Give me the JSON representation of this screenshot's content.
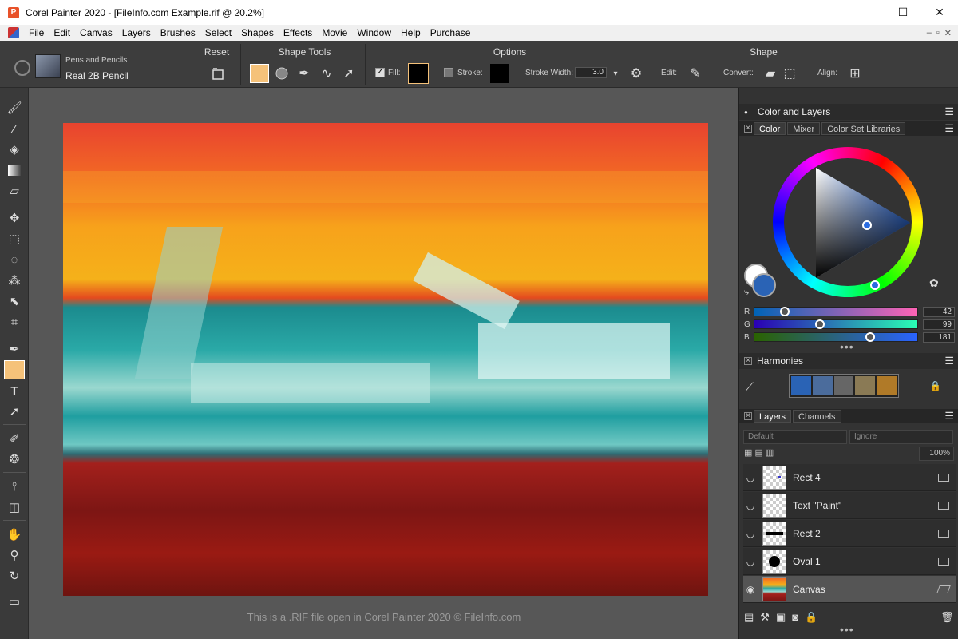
{
  "window": {
    "title": "Corel Painter 2020 - [FileInfo.com Example.rif @ 20.2%]",
    "app_icon": "painter-logo-icon",
    "minimize_glyph": "—",
    "maximize_glyph": "☐",
    "close_glyph": "✕"
  },
  "menu": {
    "items": [
      "File",
      "Edit",
      "Canvas",
      "Layers",
      "Brushes",
      "Select",
      "Shapes",
      "Effects",
      "Movie",
      "Window",
      "Help",
      "Purchase"
    ],
    "mdi_controls": [
      "–",
      "▫",
      "✕"
    ]
  },
  "property_bar": {
    "brush": {
      "category": "Pens and Pencils",
      "variant": "Real 2B Pencil"
    },
    "reset": {
      "heading": "Reset"
    },
    "shape_tools": {
      "heading": "Shape Tools"
    },
    "options": {
      "heading": "Options",
      "fill_label": "Fill:",
      "fill_checked": true,
      "stroke_label": "Stroke:",
      "stroke_checked": false,
      "stroke_width_label": "Stroke Width:",
      "stroke_width_value": "3.0",
      "fill_color": "#000000",
      "stroke_color": "#000000"
    },
    "shape": {
      "heading": "Shape",
      "edit_label": "Edit:",
      "convert_label": "Convert:",
      "align_label": "Align:"
    }
  },
  "toolbox": {
    "tools": [
      "brush-icon",
      "dropper-icon",
      "paint-bucket-icon",
      "gradient-icon",
      "eraser-icon",
      "transform-icon",
      "rect-select-icon",
      "lasso-icon",
      "magic-wand-icon",
      "selection-adjuster-icon",
      "crop-icon",
      "pen-icon",
      "rectangle-shape-icon",
      "text-icon",
      "shape-selection-icon",
      "cloner-icon",
      "blender-icon",
      "mirror-icon",
      "perspective-icon",
      "grabber-icon",
      "magnifier-icon",
      "rotate-page-icon",
      "screen-mode-icon"
    ],
    "selected": "rectangle-shape-icon"
  },
  "canvas": {
    "caption": "This is a .RIF file open in Corel Painter 2020 © FileInfo.com"
  },
  "color_panel": {
    "group_title": "Color and Layers",
    "tabs": [
      "Color",
      "Mixer",
      "Color Set Libraries"
    ],
    "current_color": "#2a63b5",
    "rgb": {
      "r_label": "R",
      "r": "42",
      "g_label": "G",
      "g": "99",
      "b_label": "B",
      "b": "181"
    },
    "levels": {
      "r": 0.165,
      "g": 0.388,
      "b": 0.71
    }
  },
  "harmonies": {
    "title": "Harmonies",
    "colors": [
      "#2a63b5",
      "#4b6c9c",
      "#666666",
      "#8a7a55",
      "#b07a28"
    ]
  },
  "layers": {
    "tabs": [
      "Layers",
      "Channels"
    ],
    "composite_method": "Default",
    "preserve": "Ignore",
    "opacity": "100%",
    "items": [
      {
        "name": "Rect 4",
        "selected": false
      },
      {
        "name": "Text \"Paint\"",
        "selected": false
      },
      {
        "name": "Rect 2",
        "selected": false
      },
      {
        "name": "Oval 1",
        "selected": false
      },
      {
        "name": "Canvas",
        "selected": true
      }
    ]
  }
}
